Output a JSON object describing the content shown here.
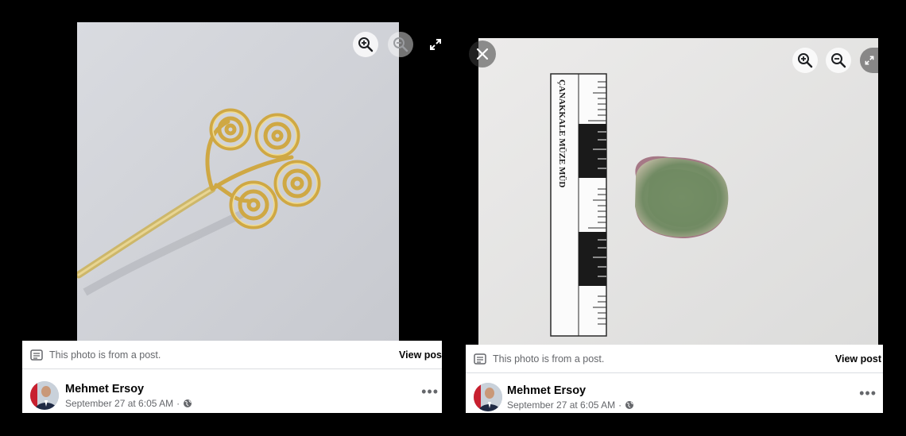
{
  "left_post": {
    "photo_notice": "This photo is from a post.",
    "view_post": "View pos",
    "author": "Mehmet Ersoy",
    "date": "September 27 at 6:05 AM",
    "separator": "·",
    "controls": [
      "zoom-in-icon",
      "zoom-out-icon",
      "fullscreen-icon"
    ]
  },
  "right_post": {
    "photo_notice": "This photo is from a post.",
    "view_post": "View post",
    "author": "Mehmet Ersoy",
    "date": "September 27 at 6:05 AM",
    "separator": "·",
    "controls": [
      "close-icon",
      "zoom-in-icon",
      "zoom-out-icon",
      "fullscreen-icon"
    ],
    "ruler_text": "ÇANAKKALE MÜZE MÜD"
  },
  "colors": {
    "background": "#000000",
    "card": "#ffffff",
    "secondary_text": "#65676b",
    "gold": "#d6b04f",
    "stone_green": "#7f9a6e"
  }
}
